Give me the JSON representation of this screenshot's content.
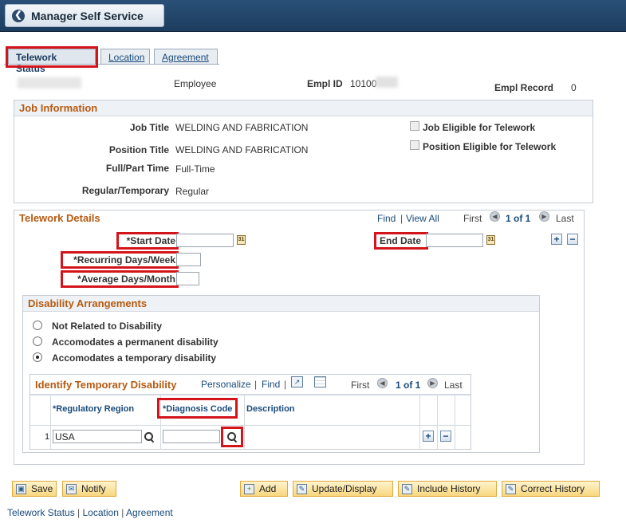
{
  "header": {
    "back_label": "Manager Self Service"
  },
  "tabs": [
    {
      "label": "Telework Status"
    },
    {
      "label": "Location"
    },
    {
      "label": "Agreement"
    }
  ],
  "employee": {
    "type_label": "Employee",
    "empl_id_label": "Empl ID",
    "empl_id_value": "10100",
    "empl_record_label": "Empl Record",
    "empl_record_value": "0"
  },
  "job_info": {
    "title": "Job Information",
    "job_title_label": "Job Title",
    "job_title_value": "WELDING AND FABRICATION",
    "position_title_label": "Position Title",
    "position_title_value": "WELDING AND FABRICATION",
    "full_part_label": "Full/Part Time",
    "full_part_value": "Full-Time",
    "reg_temp_label": "Regular/Temporary",
    "reg_temp_value": "Regular",
    "job_eligible_label": "Job Eligible for Telework",
    "position_eligible_label": "Position Eligible for Telework"
  },
  "telework": {
    "title": "Telework Details",
    "find": "Find",
    "view_all": "View All",
    "first": "First",
    "count": "1 of 1",
    "last": "Last",
    "start_date_label": "*Start Date",
    "end_date_label": "End Date",
    "recurring_label": "*Recurring Days/Week",
    "average_label": "*Average Days/Month"
  },
  "disability": {
    "title": "Disability Arrangements",
    "options": [
      "Not Related to Disability",
      "Accomodates a permanent disability",
      "Accomodates a temporary disability"
    ]
  },
  "temp_disability": {
    "title": "Identify Temporary Disability",
    "personalize": "Personalize",
    "find": "Find",
    "first": "First",
    "count": "1 of 1",
    "last": "Last",
    "columns": [
      "*Regulatory Region",
      "*Diagnosis Code",
      "Description"
    ],
    "rows": [
      {
        "num": "1",
        "region": "USA",
        "code": "",
        "description": ""
      }
    ]
  },
  "buttons": {
    "save": "Save",
    "notify": "Notify",
    "add": "Add",
    "update": "Update/Display",
    "include_history": "Include History",
    "correct_history": "Correct History"
  },
  "footer_links": [
    "Telework Status",
    "Location",
    "Agreement"
  ],
  "colors": {
    "header_bg": "#1d3d5f",
    "group_title": "#b65a10",
    "highlight": "#d4141b",
    "link": "#1a4a7a"
  }
}
